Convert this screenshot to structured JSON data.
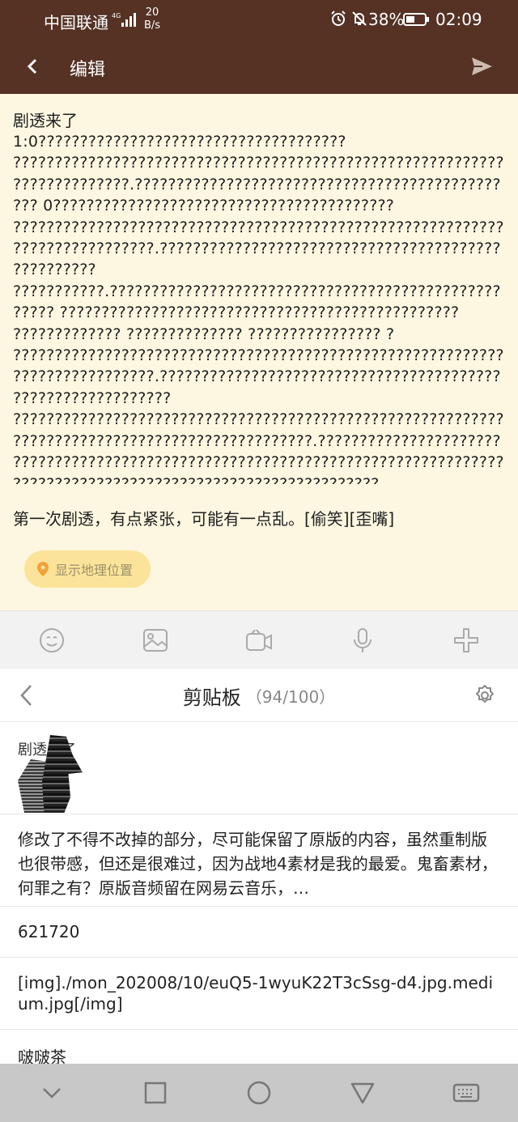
{
  "status_bar": {
    "carrier": "中国联通",
    "network_type": "4G",
    "speed_value": "20",
    "speed_unit": "B/s",
    "battery_percent": "38%",
    "time": "02:09"
  },
  "header": {
    "title": "编辑"
  },
  "editor": {
    "post_title": "剧透来了",
    "post_body": "1:0????????????????????????????????????? ?????????????????????????????????????????????????????????????????????????.??????????????????????????????????????????????? 0????????????????????????????????????????? ????????????????????????????????????????????????????????????????????????????.??????????????????????????????????????????????????? ???????????.???????????????????????????????????????????????????? ???????????????????????????????????????????????? ????????????? ?????????????? ???????????????? ? ????????????????????????????????????????????????????????????????????????????.???????????????????????????????????????????????????????????? ???????????????????????????????????????????????????????????????????????????????????????????????.????????????????????????????????????????????????????????????????????????????????????????????????????????????????????????????? ??????????????????????????????????????????????????????????????????????????.????????????????????????????????????????????????",
    "post_note": "第一次剧透，有点紧张，可能有一点乱。[偷笑][歪嘴]",
    "location_label": "显示地理位置"
  },
  "toolbar": {
    "icons": [
      "emoji-icon",
      "image-icon",
      "video-icon",
      "microphone-icon",
      "plus-icon"
    ]
  },
  "clipboard": {
    "title": "剪贴板",
    "count": "（94/100）",
    "items": [
      {
        "type": "image",
        "label": "剧透来了"
      },
      {
        "type": "text",
        "text": "修改了不得不改掉的部分，尽可能保留了原版的内容，虽然重制版也很带感，但还是很难过，因为战地4素材是我的最爱。鬼畜素材，何罪之有？原版音频留在网易云音乐，…"
      },
      {
        "type": "text",
        "text": "621720"
      },
      {
        "type": "text",
        "text": "[img]./mon_202008/10/euQ5-1wyuK22T3cSsg-d4.jpg.medium.jpg[/img]"
      },
      {
        "type": "text",
        "text": "啵啵茶"
      }
    ]
  },
  "colors": {
    "header_bg": "#553224",
    "editor_bg": "#fdf7e1",
    "location_pill_bg": "#fbe49a",
    "nav_bar_bg": "#c8c8c8"
  }
}
